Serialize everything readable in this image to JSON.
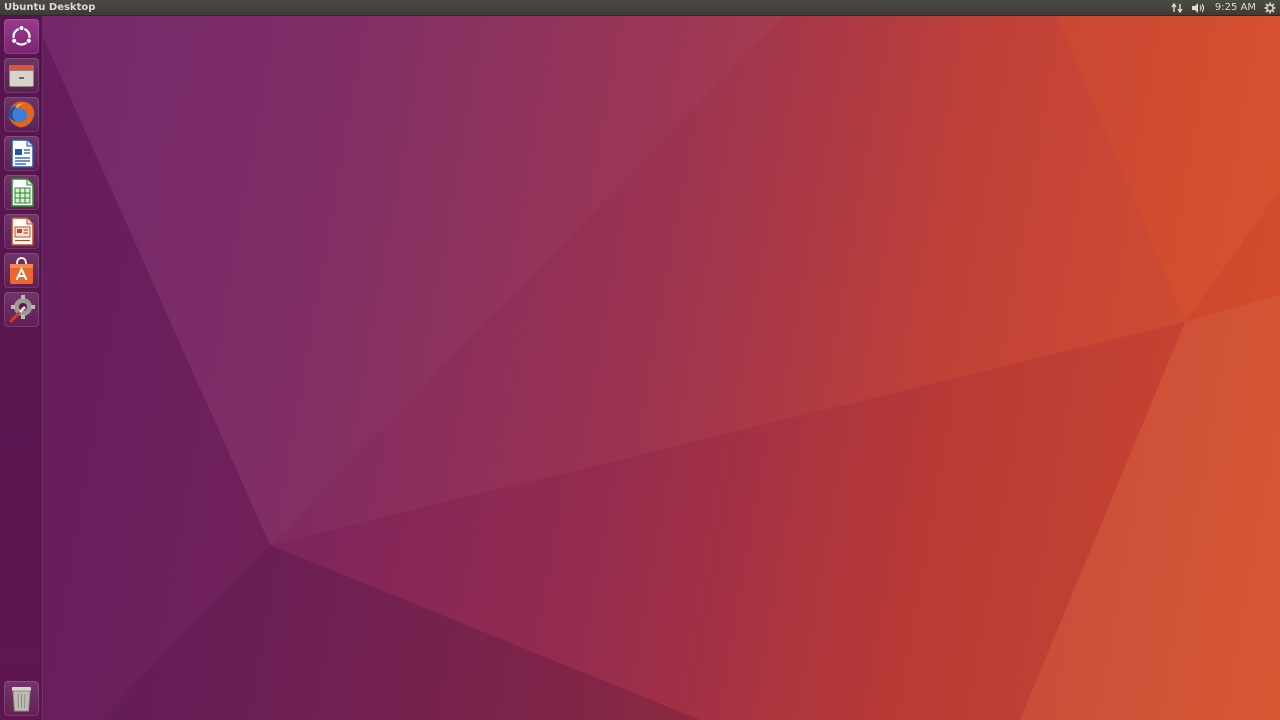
{
  "panel": {
    "title": "Ubuntu Desktop",
    "indicators": {
      "network_icon": "network-updown-icon",
      "sound_icon": "volume-icon",
      "clock": "9:25 AM",
      "session_icon": "gear-icon"
    }
  },
  "launcher": {
    "items": [
      {
        "icon": "dash-home-icon"
      },
      {
        "icon": "files-icon"
      },
      {
        "icon": "firefox-icon"
      },
      {
        "icon": "libreoffice-writer-icon"
      },
      {
        "icon": "libreoffice-calc-icon"
      },
      {
        "icon": "libreoffice-impress-icon"
      },
      {
        "icon": "ubuntu-software-icon"
      },
      {
        "icon": "system-settings-icon"
      }
    ],
    "trash": {
      "icon": "trash-icon"
    }
  },
  "colors": {
    "panel_bg": "#3c3b37",
    "launcher_bg": "#5e1650",
    "wallpaper_start": "#6c1f66",
    "wallpaper_end": "#d6502a"
  }
}
